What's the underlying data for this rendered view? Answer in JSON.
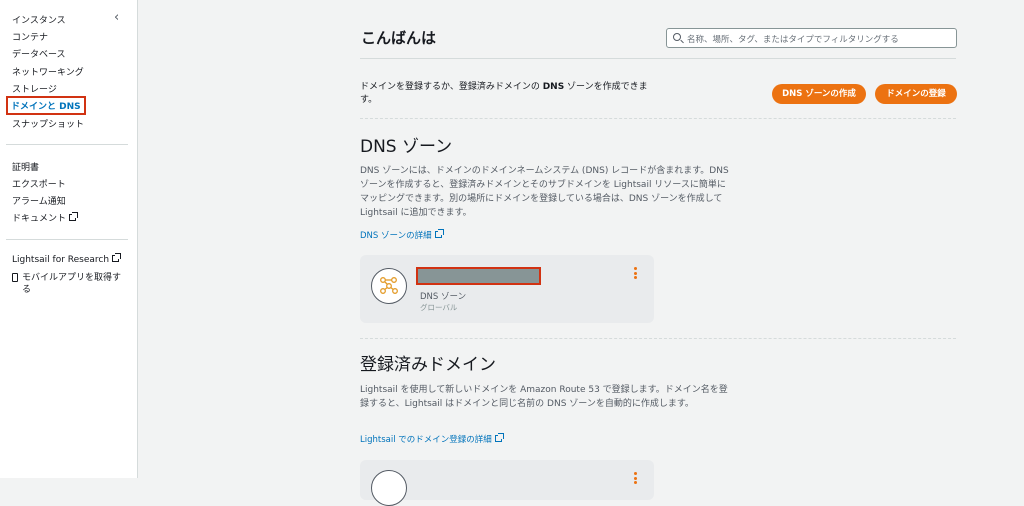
{
  "sidebar": {
    "collapse_icon": "‹",
    "group1": [
      "インスタンス",
      "コンテナ",
      "データベース",
      "ネットワーキング",
      "ストレージ",
      "ドメインと DNS",
      "スナップショット"
    ],
    "group2": [
      "証明書",
      "エクスポート",
      "アラーム通知",
      "ドキュメント"
    ],
    "research_label": "Lightsail for Research",
    "mobile_label_1": "モバイルアプリを取得す",
    "mobile_label_2": "る"
  },
  "header": {
    "title": "こんばんは",
    "search_placeholder": "名称、場所、タグ、またはタイプでフィルタリングする"
  },
  "intro": {
    "text_before": "ドメインを登録するか、登録済みドメインの ",
    "text_bold": "DNS",
    "text_after": " ゾーンを作成できます。",
    "create_zone_button": "DNS ゾーンの作成",
    "register_domain_button": "ドメインの登録"
  },
  "dns_section": {
    "title": "DNS ゾーン",
    "description": "DNS ゾーンには、ドメインのドメインネームシステム (DNS) レコードが含まれます。DNS ゾーンを作成すると、登録済みドメインとそのサブドメインを Lightsail リソースに簡単にマッピングできます。別の場所にドメインを登録している場合は、DNS ゾーンを作成して Lightsail に追加できます。",
    "link": "DNS ゾーンの詳細",
    "card": {
      "type": "DNS ゾーン",
      "scope": "グローバル"
    }
  },
  "domain_section": {
    "title": "登録済みドメイン",
    "description": "Lightsail を使用して新しいドメインを Amazon Route 53 で登録します。ドメイン名を登録すると、Lightsail はドメインと同じ名前の DNS ゾーンを自動的に作成します。",
    "link": "Lightsail でのドメイン登録の詳細"
  },
  "colors": {
    "accent": "#ec7211",
    "link": "#0073bb",
    "highlight": "#d13212"
  }
}
